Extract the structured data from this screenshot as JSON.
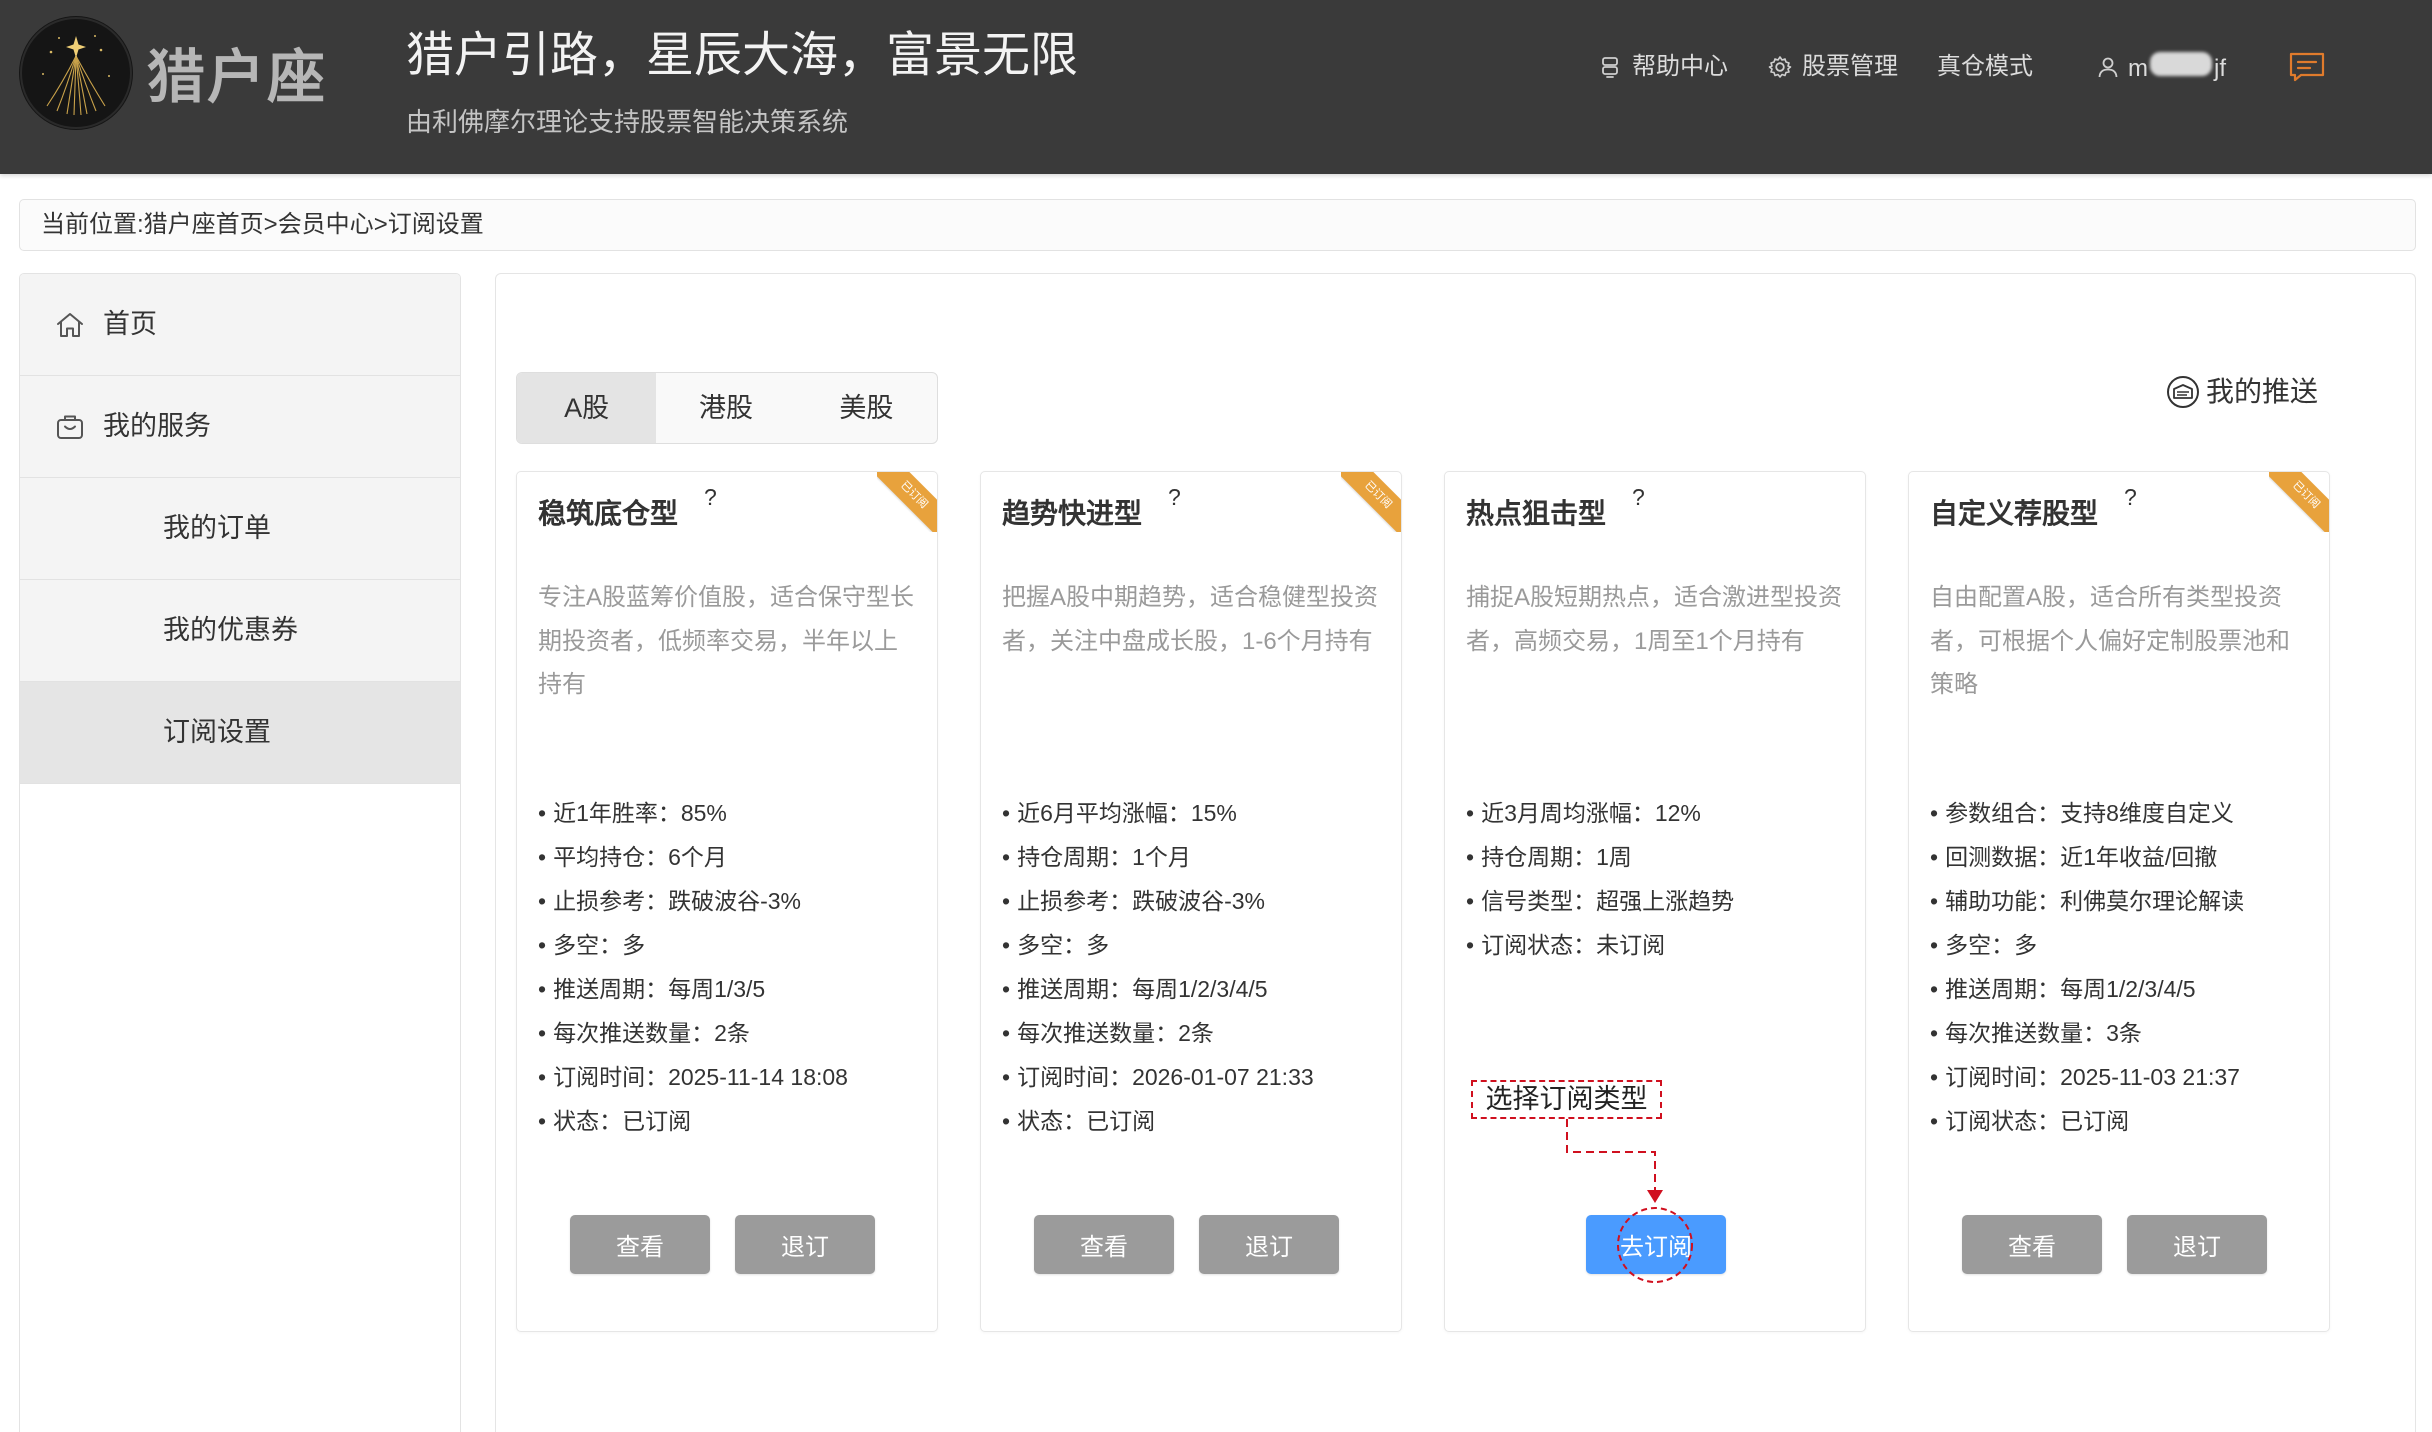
{
  "header": {
    "logo_icon": "orion-logo-icon",
    "logo_text": "猎户座",
    "title": "猎户引路，星辰大海，富景无限",
    "subtitle": "由利佛摩尔理论支持股票智能决策系统",
    "nav": {
      "help": {
        "icon": "help-center-icon",
        "label": "帮助中心"
      },
      "stock_manage": {
        "icon": "gear-icon",
        "label": "股票管理"
      },
      "real_mode": {
        "label": "真仓模式"
      },
      "user": {
        "icon": "user-icon",
        "name_start": "m",
        "name_end": "jf"
      },
      "message": {
        "icon": "message-icon"
      }
    }
  },
  "breadcrumb": {
    "prefix": "当前位置:",
    "separator": ">",
    "links": [
      "猎户座首页",
      "会员中心",
      "订阅设置"
    ]
  },
  "sidebar": {
    "items": [
      {
        "icon": "home-icon",
        "label": "首页"
      },
      {
        "icon": "service-bag-icon",
        "label": "我的服务"
      },
      {
        "label": "我的订单"
      },
      {
        "label": "我的优惠券"
      },
      {
        "label": "订阅设置",
        "active": true
      }
    ]
  },
  "market_tabs": [
    {
      "label": "A股",
      "active": true
    },
    {
      "label": "港股"
    },
    {
      "label": "美股"
    }
  ],
  "my_push": {
    "icon": "push-icon",
    "label": "我的推送"
  },
  "cards": [
    {
      "title": "稳筑底仓型",
      "help_mark": "?",
      "badge": "已订阅",
      "description": "专注A股蓝筹价值股，适合保守型长期投资者，低频率交易，半年以上持有",
      "items": [
        "近1年胜率：85%",
        "平均持仓：6个月",
        "止损参考：跌破波谷-3%",
        "多空：多",
        "推送周期：每周1/3/5",
        "每次推送数量：2条",
        "订阅时间：2025-11-14 18:08",
        "状态：已订阅"
      ],
      "buttons": [
        "查看",
        "退订"
      ]
    },
    {
      "title": "趋势快进型",
      "help_mark": "?",
      "badge": "已订阅",
      "description": "把握A股中期趋势，适合稳健型投资者，关注中盘成长股，1-6个月持有",
      "items": [
        "近6月平均涨幅：15%",
        "持仓周期：1个月",
        "止损参考：跌破波谷-3%",
        "多空：多",
        "推送周期：每周1/2/3/4/5",
        "每次推送数量：2条",
        "订阅时间：2026-01-07 21:33",
        "状态：已订阅"
      ],
      "buttons": [
        "查看",
        "退订"
      ]
    },
    {
      "title": "热点狙击型",
      "help_mark": "?",
      "description": "捕捉A股短期热点，适合激进型投资者，高频交易，1周至1个月持有",
      "items": [
        "近3月周均涨幅：12%",
        "持仓周期：1周",
        "信号类型：超强上涨趋势",
        "订阅状态：未订阅"
      ],
      "buttons": [
        "去订阅"
      ],
      "annotation": "选择订阅类型"
    },
    {
      "title": "自定义荐股型",
      "help_mark": "?",
      "badge": "已订阅",
      "description": "自由配置A股，适合所有类型投资者，可根据个人偏好定制股票池和策略",
      "items": [
        "参数组合：支持8维度自定义",
        "回测数据：近1年收益/回撤",
        "辅助功能：利佛莫尔理论解读",
        "多空：多",
        "推送周期：每周1/2/3/4/5",
        "每次推送数量：3条",
        "订阅时间：2025-11-03 21:37",
        "订阅状态：已订阅"
      ],
      "buttons": [
        "查看",
        "退订"
      ]
    }
  ],
  "colors": {
    "header_bg": "#3a3a3a",
    "primary_blue": "#4a9bff",
    "badge_orange": "#e8a23c",
    "annotation_red": "#d0101f",
    "button_gray": "#9b9b9b"
  }
}
